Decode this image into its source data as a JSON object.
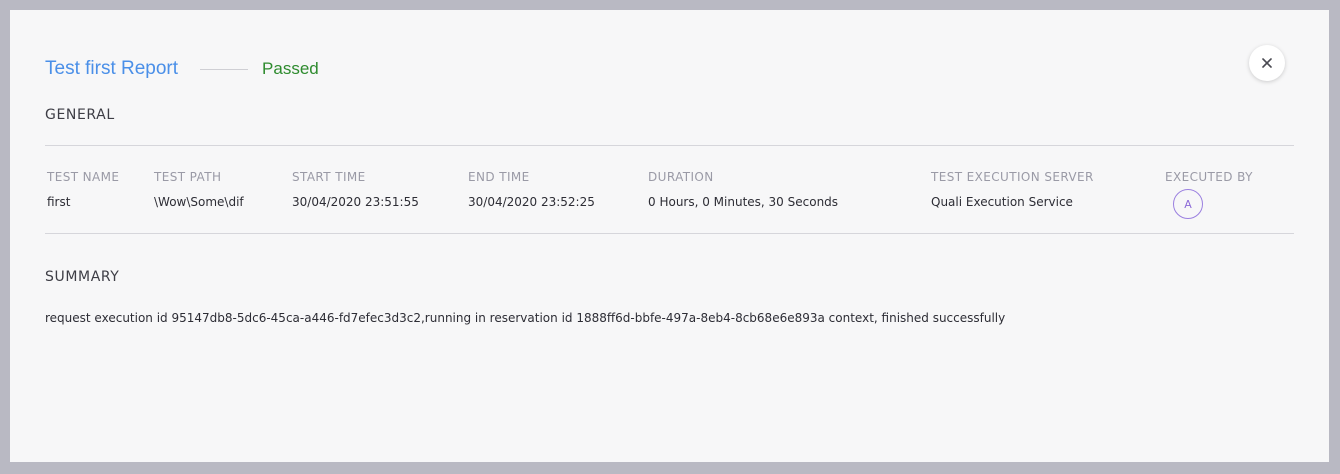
{
  "report": {
    "title": "Test first Report",
    "status": "Passed"
  },
  "general": {
    "heading": "GENERAL",
    "columns": [
      {
        "label": "TEST NAME",
        "value": "first"
      },
      {
        "label": "TEST PATH",
        "value": "\\Wow\\Some\\dif"
      },
      {
        "label": "START TIME",
        "value": "30/04/2020 23:51:55"
      },
      {
        "label": "END TIME",
        "value": "30/04/2020 23:52:25"
      },
      {
        "label": "DURATION",
        "value": "0 Hours, 0 Minutes, 30 Seconds"
      },
      {
        "label": "TEST EXECUTION SERVER",
        "value": "Quali Execution Service"
      },
      {
        "label": "EXECUTED BY",
        "value": "A"
      }
    ]
  },
  "summary": {
    "heading": "SUMMARY",
    "text": "request execution id 95147db8-5dc6-45ca-a446-fd7efec3d3c2,running in reservation id 1888ff6d-bbfe-497a-8eb4-8cb68e6e893a context, finished successfully"
  },
  "icons": {
    "close": "close-icon"
  },
  "colors": {
    "title": "#4a8fe8",
    "status_passed": "#2e8b2e",
    "avatar_border": "#9b80e0",
    "overlay": "#b9b9c3"
  }
}
